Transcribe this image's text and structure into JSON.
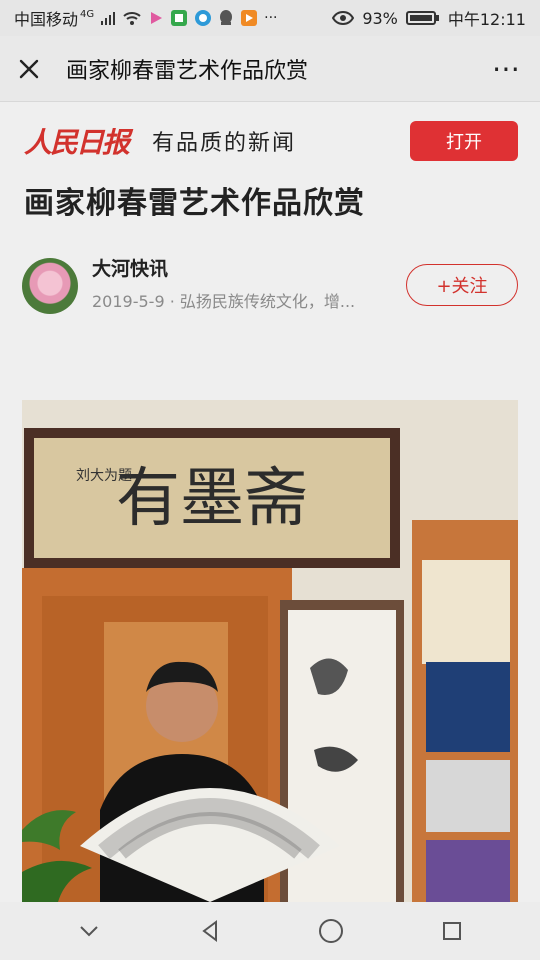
{
  "status_bar": {
    "carrier": "中国移动",
    "network": "4G",
    "battery": "93%",
    "time": "中午12:11"
  },
  "title_bar": {
    "title": "画家柳春雷艺术作品欣赏"
  },
  "promo": {
    "logo": "人民日报",
    "slogan": "有品质的新闻",
    "open_label": "打开"
  },
  "article": {
    "title": "画家柳春雷艺术作品欣赏",
    "author": "大河快讯",
    "meta": "2019-5-9 · 弘扬民族传统文化，增...",
    "follow_label": "+关注"
  },
  "photo": {
    "calligraphy_main": "有墨斋",
    "calligraphy_side": "刘大为题"
  },
  "colors": {
    "accent": "#df3134",
    "brand": "#d2322d"
  }
}
